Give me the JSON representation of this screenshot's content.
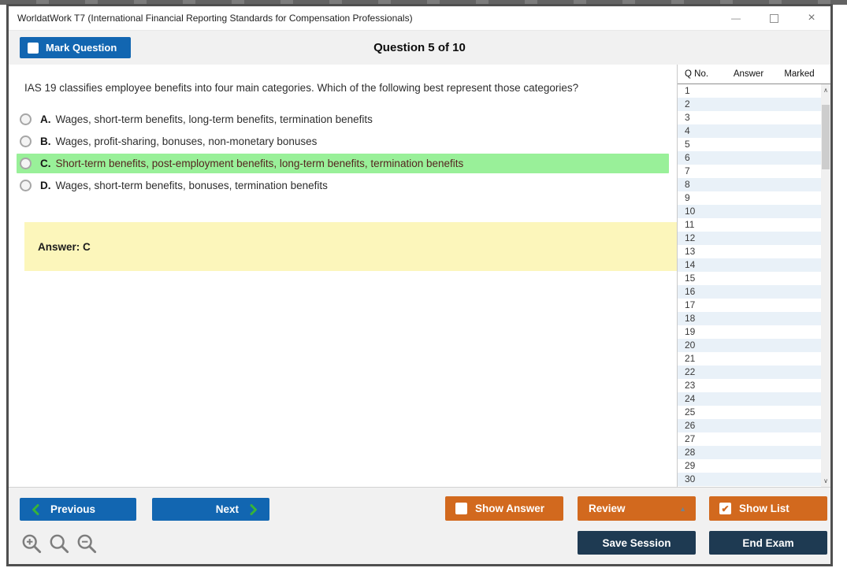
{
  "window": {
    "title": "WorldatWork T7 (International Financial Reporting Standards for Compensation Professionals)"
  },
  "header": {
    "mark_question_label": "Mark Question",
    "mark_question_checked": false,
    "question_counter": "Question 5 of 10"
  },
  "question": {
    "text": "IAS 19 classifies employee benefits into four main categories. Which of the following best represent those categories?",
    "options": [
      {
        "letter": "A.",
        "text": "Wages, short-term benefits, long-term benefits, termination benefits",
        "highlighted": false
      },
      {
        "letter": "B.",
        "text": "Wages, profit-sharing, bonuses, non-monetary bonuses",
        "highlighted": false
      },
      {
        "letter": "C.",
        "text": "Short-term benefits, post-employment benefits, long-term benefits, termination benefits",
        "highlighted": true
      },
      {
        "letter": "D.",
        "text": "Wages, short-term benefits, bonuses, termination benefits",
        "highlighted": false
      }
    ],
    "answer_label": "Answer: C"
  },
  "question_list": {
    "columns": {
      "qno": "Q No.",
      "answer": "Answer",
      "marked": "Marked"
    },
    "rows": [
      {
        "q": "1",
        "answer": "",
        "marked": ""
      },
      {
        "q": "2",
        "answer": "",
        "marked": ""
      },
      {
        "q": "3",
        "answer": "",
        "marked": ""
      },
      {
        "q": "4",
        "answer": "",
        "marked": ""
      },
      {
        "q": "5",
        "answer": "",
        "marked": ""
      },
      {
        "q": "6",
        "answer": "",
        "marked": ""
      },
      {
        "q": "7",
        "answer": "",
        "marked": ""
      },
      {
        "q": "8",
        "answer": "",
        "marked": ""
      },
      {
        "q": "9",
        "answer": "",
        "marked": ""
      },
      {
        "q": "10",
        "answer": "",
        "marked": ""
      },
      {
        "q": "11",
        "answer": "",
        "marked": ""
      },
      {
        "q": "12",
        "answer": "",
        "marked": ""
      },
      {
        "q": "13",
        "answer": "",
        "marked": ""
      },
      {
        "q": "14",
        "answer": "",
        "marked": ""
      },
      {
        "q": "15",
        "answer": "",
        "marked": ""
      },
      {
        "q": "16",
        "answer": "",
        "marked": ""
      },
      {
        "q": "17",
        "answer": "",
        "marked": ""
      },
      {
        "q": "18",
        "answer": "",
        "marked": ""
      },
      {
        "q": "19",
        "answer": "",
        "marked": ""
      },
      {
        "q": "20",
        "answer": "",
        "marked": ""
      },
      {
        "q": "21",
        "answer": "",
        "marked": ""
      },
      {
        "q": "22",
        "answer": "",
        "marked": ""
      },
      {
        "q": "23",
        "answer": "",
        "marked": ""
      },
      {
        "q": "24",
        "answer": "",
        "marked": ""
      },
      {
        "q": "25",
        "answer": "",
        "marked": ""
      },
      {
        "q": "26",
        "answer": "",
        "marked": ""
      },
      {
        "q": "27",
        "answer": "",
        "marked": ""
      },
      {
        "q": "28",
        "answer": "",
        "marked": ""
      },
      {
        "q": "29",
        "answer": "",
        "marked": ""
      },
      {
        "q": "30",
        "answer": "",
        "marked": ""
      }
    ]
  },
  "footer": {
    "previous_label": "Previous",
    "next_label": "Next",
    "show_answer_label": "Show Answer",
    "show_answer_checked": false,
    "review_label": "Review",
    "show_list_label": "Show List",
    "show_list_checked": true,
    "save_session_label": "Save Session",
    "end_exam_label": "End Exam"
  },
  "icons": {
    "minimize": "—",
    "close": "×",
    "scroll_up": "∧",
    "scroll_down": "∨",
    "review_caret": "▲",
    "checkmark": "✔"
  },
  "colors": {
    "blue": "#1266b1",
    "orange": "#d2691e",
    "navy": "#1e3a52",
    "highlight_green": "#99f099",
    "answer_yellow": "#fcf6bb"
  }
}
